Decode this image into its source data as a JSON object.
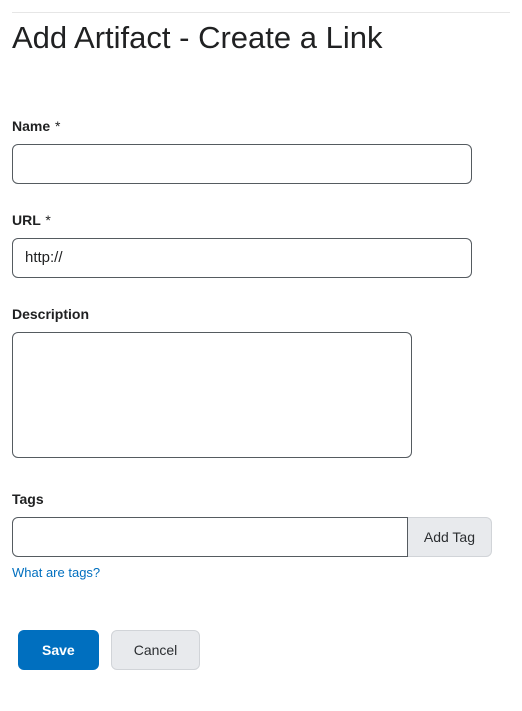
{
  "page": {
    "title": "Add Artifact - Create a Link"
  },
  "form": {
    "name": {
      "label": "Name",
      "required_marker": "*",
      "value": ""
    },
    "url": {
      "label": "URL",
      "required_marker": "*",
      "value": "http://"
    },
    "description": {
      "label": "Description",
      "value": ""
    },
    "tags": {
      "label": "Tags",
      "value": "",
      "add_button_label": "Add Tag",
      "help_link_text": "What are tags?"
    }
  },
  "actions": {
    "save_label": "Save",
    "cancel_label": "Cancel"
  }
}
